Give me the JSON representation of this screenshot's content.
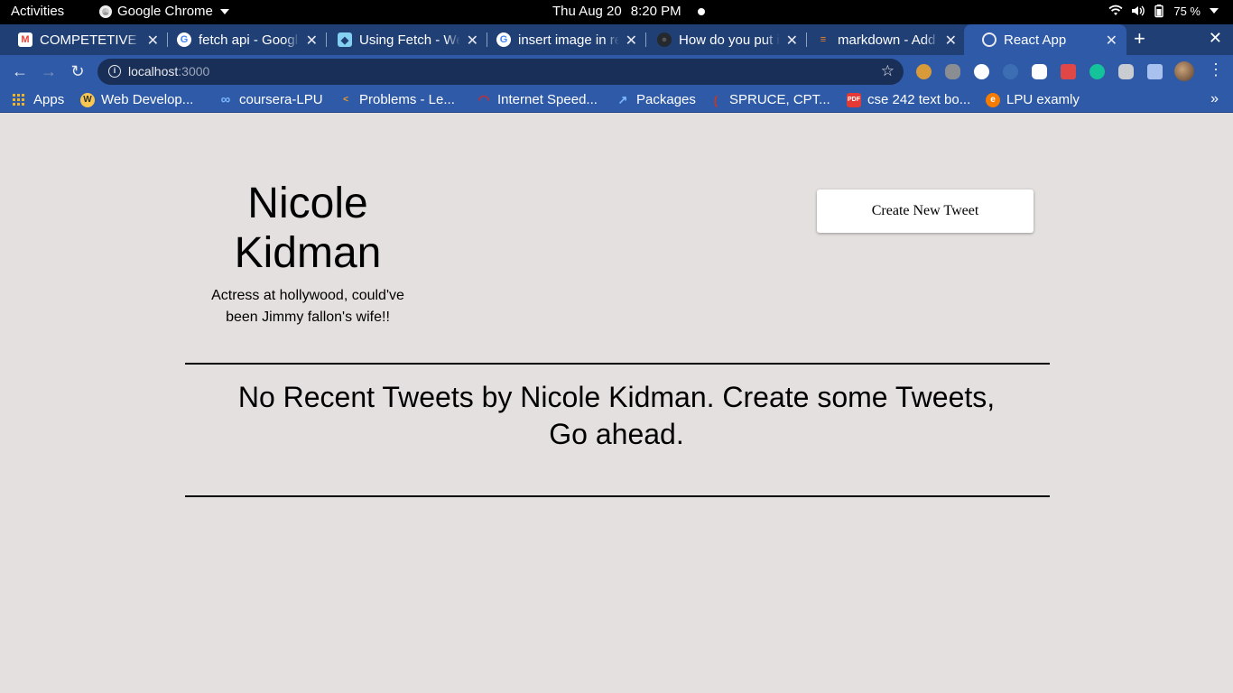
{
  "system_bar": {
    "activities": "Activities",
    "app_name": "Google Chrome",
    "date": "Thu Aug 20",
    "time": "8:20 PM",
    "battery": "75 %"
  },
  "tabs": [
    {
      "title": "COMPETETIVE E",
      "icon": "gmail-icon",
      "color": "#ea4335"
    },
    {
      "title": "fetch api - Googl",
      "icon": "google-icon",
      "color": "#4285f4"
    },
    {
      "title": "Using Fetch - We",
      "icon": "mdn-icon",
      "color": "#83d0f2"
    },
    {
      "title": "insert image in re",
      "icon": "google-icon",
      "color": "#4285f4"
    },
    {
      "title": "How do you put i",
      "icon": "github-icon",
      "color": "#24292e"
    },
    {
      "title": "markdown - Add",
      "icon": "stackoverflow-icon",
      "color": "#f48024"
    },
    {
      "title": "React App",
      "icon": "globe-icon",
      "color": "#e8eaed",
      "active": true
    }
  ],
  "address_bar": {
    "host": "localhost",
    "port": ":3000"
  },
  "bookmarks": [
    {
      "label": "Apps",
      "icon": "apps-grid-icon"
    },
    {
      "label": "Web Develop...",
      "icon": "web-dev-icon",
      "color": "#f9c74f"
    },
    {
      "label": "coursera-LPU",
      "icon": "infinity-icon",
      "color": "#7ab8ff"
    },
    {
      "label": "Problems - Le...",
      "icon": "leetcode-icon",
      "color": "#f89f1b"
    },
    {
      "label": "Internet Speed...",
      "icon": "speedometer-icon",
      "color": "#d62828"
    },
    {
      "label": "Packages",
      "icon": "external-link-icon",
      "color": "#7ab8ff"
    },
    {
      "label": "SPRUCE, CPT...",
      "icon": "spruce-icon",
      "color": "#c0392b"
    },
    {
      "label": "cse 242 text bo...",
      "icon": "pdf-icon",
      "color": "#e53935"
    },
    {
      "label": "LPU examly",
      "icon": "examly-icon",
      "color": "#f57c00"
    }
  ],
  "profile": {
    "name": "Nicole Kidman",
    "bio": "Actress at hollywood, could've been Jimmy fallon's wife!!"
  },
  "actions": {
    "create_tweet": "Create New Tweet"
  },
  "feed": {
    "empty_message": "No Recent Tweets by Nicole Kidman. Create some Tweets, Go ahead."
  }
}
